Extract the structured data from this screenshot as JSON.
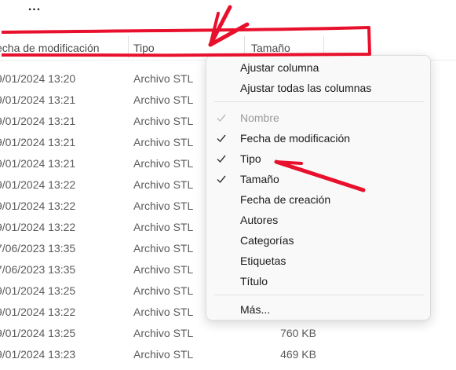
{
  "toolbar": {
    "more_label": "..."
  },
  "columns": {
    "date": "echa de modificación",
    "type": "Tipo",
    "size": "Tamaño"
  },
  "rows": [
    {
      "date": "9/01/2024 13:20",
      "type": "Archivo STL",
      "size": ""
    },
    {
      "date": "9/01/2024 13:21",
      "type": "Archivo STL",
      "size": ""
    },
    {
      "date": "9/01/2024 13:21",
      "type": "Archivo STL",
      "size": ""
    },
    {
      "date": "9/01/2024 13:21",
      "type": "Archivo STL",
      "size": ""
    },
    {
      "date": "9/01/2024 13:21",
      "type": "Archivo STL",
      "size": ""
    },
    {
      "date": "9/01/2024 13:22",
      "type": "Archivo STL",
      "size": ""
    },
    {
      "date": "9/01/2024 13:22",
      "type": "Archivo STL",
      "size": ""
    },
    {
      "date": "9/01/2024 13:22",
      "type": "Archivo STL",
      "size": ""
    },
    {
      "date": "7/06/2023 13:35",
      "type": "Archivo STL",
      "size": ""
    },
    {
      "date": "7/06/2023 13:35",
      "type": "Archivo STL",
      "size": ""
    },
    {
      "date": "9/01/2024 13:25",
      "type": "Archivo STL",
      "size": ""
    },
    {
      "date": "9/01/2024 13:22",
      "type": "Archivo STL",
      "size": ""
    },
    {
      "date": "9/01/2024 13:25",
      "type": "Archivo STL",
      "size": "760 KB"
    },
    {
      "date": "9/01/2024 13:23",
      "type": "Archivo STL",
      "size": "469 KB"
    }
  ],
  "menu": {
    "fit_column": "Ajustar columna",
    "fit_all": "Ajustar todas las columnas",
    "items": [
      {
        "label": "Nombre",
        "checked": true,
        "disabled": true
      },
      {
        "label": "Fecha de modificación",
        "checked": true,
        "disabled": false
      },
      {
        "label": "Tipo",
        "checked": true,
        "disabled": false
      },
      {
        "label": "Tamaño",
        "checked": true,
        "disabled": false
      },
      {
        "label": "Fecha de creación",
        "checked": false,
        "disabled": false
      },
      {
        "label": "Autores",
        "checked": false,
        "disabled": false
      },
      {
        "label": "Categorías",
        "checked": false,
        "disabled": false
      },
      {
        "label": "Etiquetas",
        "checked": false,
        "disabled": false
      },
      {
        "label": "Título",
        "checked": false,
        "disabled": false
      }
    ],
    "more": "Más..."
  },
  "colors": {
    "annotation": "#e8102c",
    "check": "#333333",
    "disabled": "#9a9a9a"
  }
}
